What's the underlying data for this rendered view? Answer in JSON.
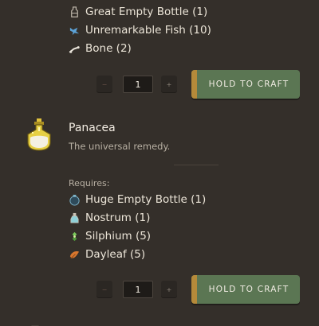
{
  "top_recipe": {
    "requirements": [
      {
        "label": "Great Empty Bottle (1)",
        "icon": "bottle-icon"
      },
      {
        "label": "Unremarkable Fish (10)",
        "icon": "fish-icon"
      },
      {
        "label": "Bone (2)",
        "icon": "bone-icon"
      }
    ],
    "quantity": "1",
    "minus_label": "−",
    "plus_label": "+",
    "craft_label": "HOLD TO CRAFT"
  },
  "panacea_recipe": {
    "title": "Panacea",
    "description": "The universal remedy.",
    "requires_label": "Requires:",
    "icon": "panacea-potion-icon",
    "requirements": [
      {
        "label": "Huge Empty Bottle (1)",
        "icon": "huge-bottle-icon"
      },
      {
        "label": "Nostrum (1)",
        "icon": "nostrum-icon"
      },
      {
        "label": "Silphium (5)",
        "icon": "silphium-icon"
      },
      {
        "label": "Dayleaf (5)",
        "icon": "dayleaf-icon"
      }
    ],
    "quantity": "1",
    "minus_label": "−",
    "plus_label": "+",
    "craft_label": "HOLD TO CRAFT"
  },
  "colors": {
    "background": "#342f2a",
    "craft_button": "#5b7653",
    "craft_button_edge": "#b58a3a"
  }
}
